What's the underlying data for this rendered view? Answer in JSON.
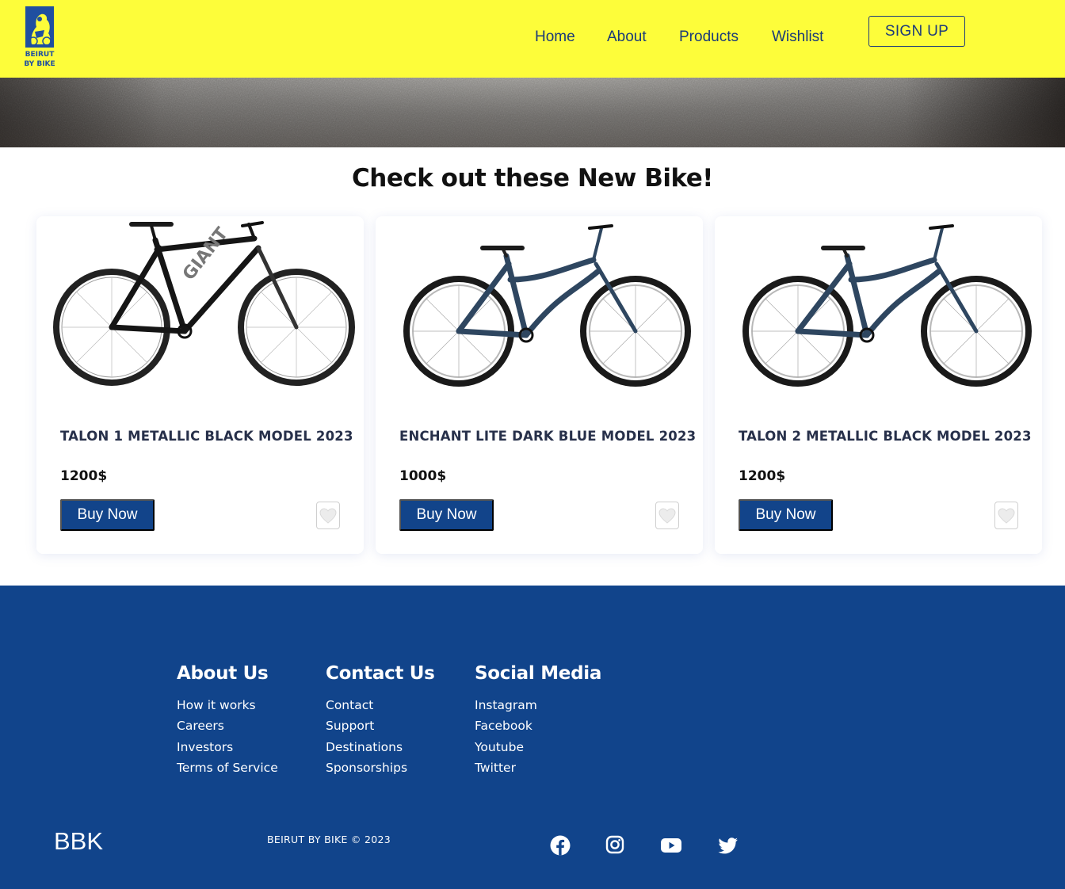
{
  "brand": {
    "logo_line1": "BEIRUT",
    "logo_line2": "BY BIKE",
    "primary_color": "#11448b",
    "header_color": "#fdfd3a"
  },
  "nav": {
    "items": [
      {
        "label": "Home"
      },
      {
        "label": "About"
      },
      {
        "label": "Products"
      },
      {
        "label": "Wishlist"
      }
    ],
    "signup_label": "SIGN UP"
  },
  "section": {
    "title": "Check out these New Bike!"
  },
  "products": [
    {
      "name": "TALON 1 METALLIC BLACK MODEL 2023",
      "price": "1200$",
      "buy_label": "Buy Now",
      "frame_color": "#1a1a1a"
    },
    {
      "name": "ENCHANT LITE DARK BLUE MODEL 2023",
      "price": "1000$",
      "buy_label": "Buy Now",
      "frame_color": "#2e4660"
    },
    {
      "name": "TALON 2 METALLIC BLACK MODEL 2023",
      "price": "1200$",
      "buy_label": "Buy Now",
      "frame_color": "#2e4660"
    }
  ],
  "footer": {
    "columns": [
      {
        "heading": "About Us",
        "links": [
          "How it works",
          "Careers",
          "Investors",
          "Terms of Service"
        ]
      },
      {
        "heading": "Contact Us",
        "links": [
          "Contact",
          "Support",
          "Destinations",
          "Sponsorships"
        ]
      },
      {
        "heading": "Social Media",
        "links": [
          "Instagram",
          "Facebook",
          "Youtube",
          "Twitter"
        ]
      }
    ],
    "brand_short": "BBK",
    "copyright": "BEIRUT BY BIKE © 2023",
    "social_icons": [
      "facebook-icon",
      "instagram-icon",
      "youtube-icon",
      "twitter-icon"
    ]
  }
}
